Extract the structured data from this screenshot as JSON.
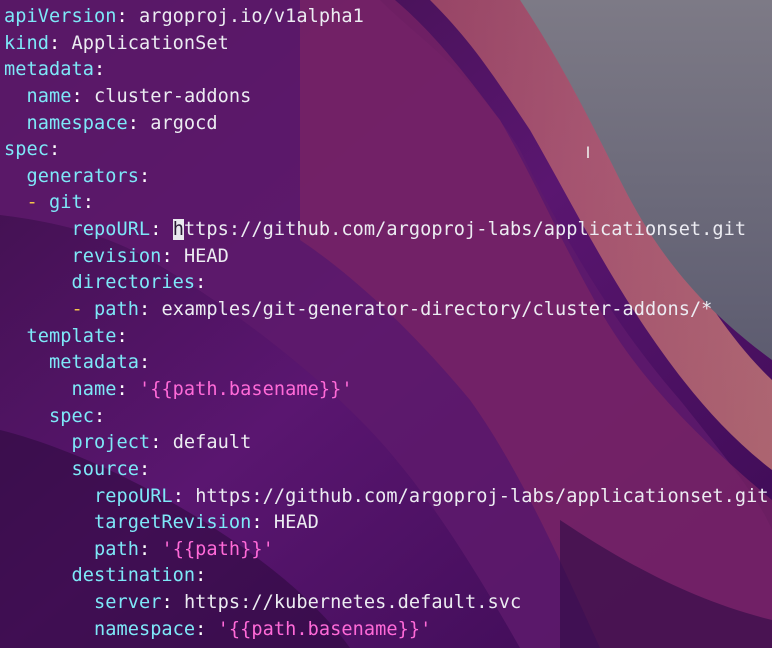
{
  "lines": [
    {
      "indent": "",
      "key": "apiVersion",
      "value": "argoproj.io/v1alpha1"
    },
    {
      "indent": "",
      "key": "kind",
      "value": "ApplicationSet"
    },
    {
      "indent": "",
      "key": "metadata"
    },
    {
      "indent": "  ",
      "key": "name",
      "value": "cluster-addons"
    },
    {
      "indent": "  ",
      "key": "namespace",
      "value": "argocd"
    },
    {
      "indent": "",
      "key": "spec"
    },
    {
      "indent": "  ",
      "key": "generators"
    },
    {
      "indent": "  ",
      "dash": true,
      "key": "git"
    },
    {
      "indent": "      ",
      "key": "repoURL",
      "cursor_char": "h",
      "value": "ttps://github.com/argoproj-labs/applicationset.git"
    },
    {
      "indent": "      ",
      "key": "revision",
      "value": "HEAD"
    },
    {
      "indent": "      ",
      "key": "directories"
    },
    {
      "indent": "      ",
      "dash": true,
      "key": "path",
      "value": "examples/git-generator-directory/cluster-addons/*"
    },
    {
      "indent": "  ",
      "key": "template"
    },
    {
      "indent": "    ",
      "key": "metadata"
    },
    {
      "indent": "      ",
      "key": "name",
      "value": "'{{path.basename}}'",
      "string": true
    },
    {
      "indent": "    ",
      "key": "spec"
    },
    {
      "indent": "      ",
      "key": "project",
      "value": "default"
    },
    {
      "indent": "      ",
      "key": "source"
    },
    {
      "indent": "        ",
      "key": "repoURL",
      "value": "https://github.com/argoproj-labs/applicationset.git"
    },
    {
      "indent": "        ",
      "key": "targetRevision",
      "value": "HEAD"
    },
    {
      "indent": "        ",
      "key": "path",
      "value": "'{{path}}'",
      "string": true
    },
    {
      "indent": "      ",
      "key": "destination"
    },
    {
      "indent": "        ",
      "key": "server",
      "value": "https://kubernetes.default.svc"
    },
    {
      "indent": "        ",
      "key": "namespace",
      "value": "'{{path.basename}}'",
      "string": true
    }
  ],
  "syntax": {
    "colon": ":",
    "dash": "- "
  },
  "pointer_glyph": "I",
  "colors": {
    "key": "#7ee8f8",
    "string": "#ff6ad8",
    "value": "#ececf2",
    "dash": "#f4c64a",
    "background": "#4a1260"
  }
}
